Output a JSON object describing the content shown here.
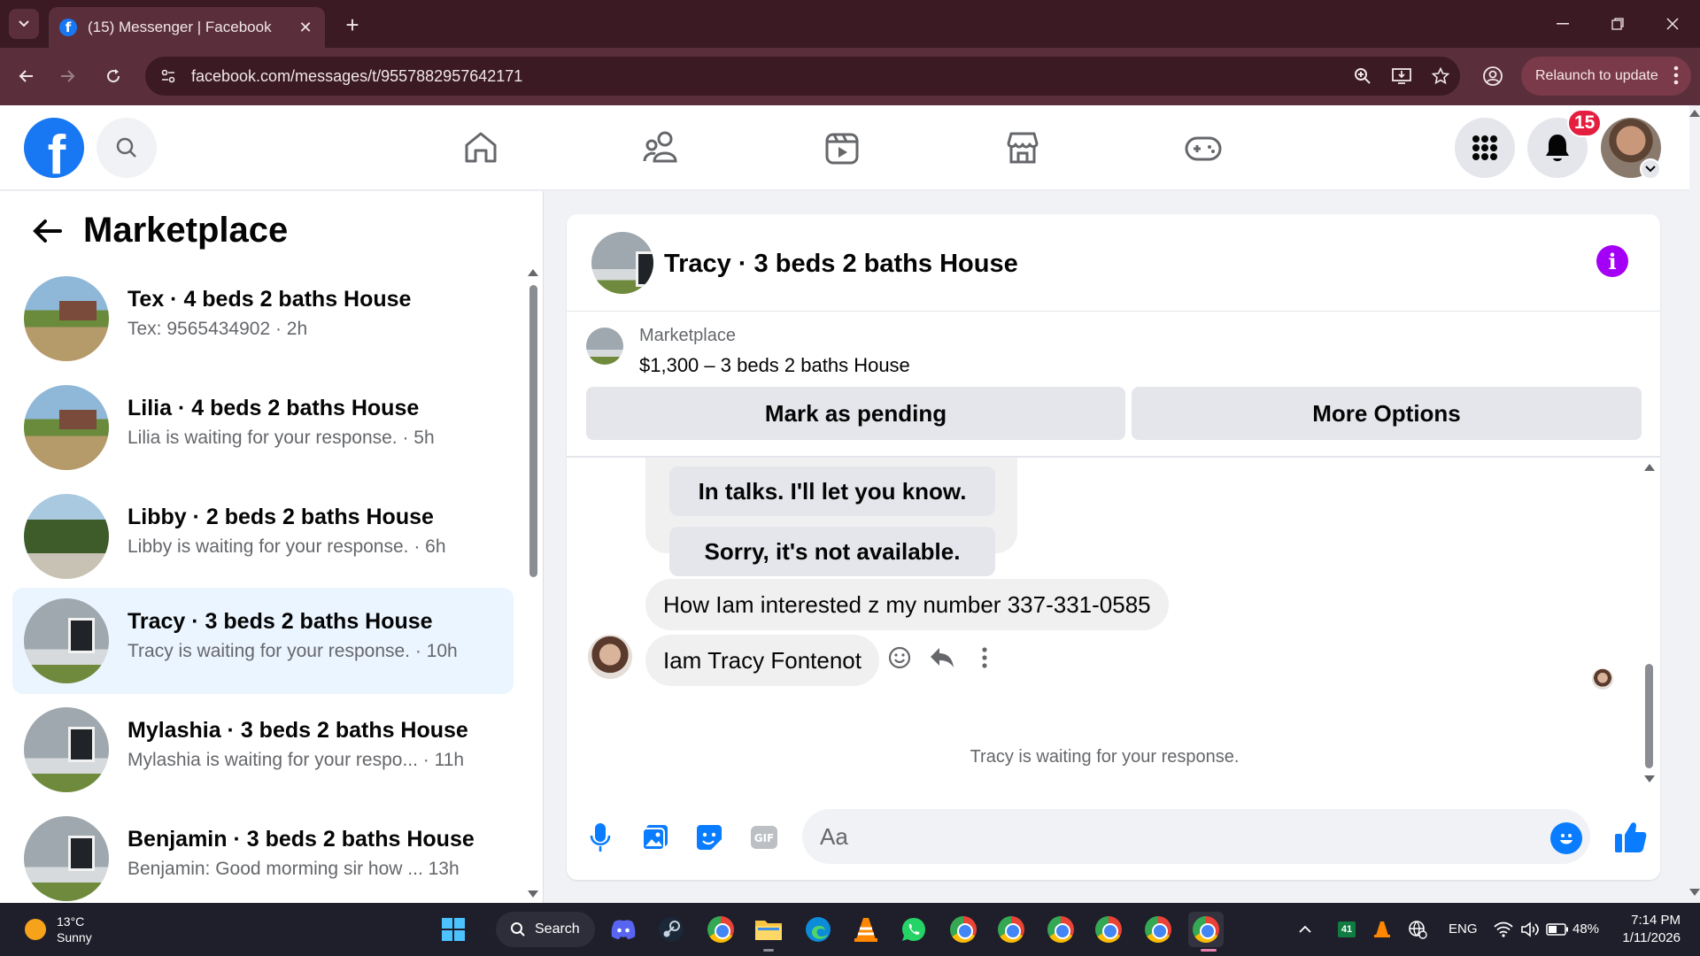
{
  "browser": {
    "tab_title": "(15) Messenger | Facebook",
    "url": "facebook.com/messages/t/9557882957642171",
    "relaunch_label": "Relaunch to update"
  },
  "fb_header": {
    "notification_count": "15",
    "nav_icons": [
      "home-icon",
      "friends-icon",
      "video-icon",
      "marketplace-icon",
      "gaming-icon"
    ]
  },
  "left_panel": {
    "title": "Marketplace",
    "conversations": [
      {
        "name": "Tex · 4 beds 2 baths House",
        "preview": "Tex: 9565434902 · 2h",
        "active": false
      },
      {
        "name": "Lilia · 4 beds 2 baths House",
        "preview": "Lilia is waiting for your response. · 5h",
        "active": false
      },
      {
        "name": "Libby · 2 beds 2 baths House",
        "preview": "Libby is waiting for your response. · 6h",
        "active": false
      },
      {
        "name": "Tracy · 3 beds 2 baths House",
        "preview": "Tracy is waiting for your response. · 10h",
        "active": true
      },
      {
        "name": "Mylashia · 3 beds 2 baths House",
        "preview": "Mylashia is waiting for your respo...  · 11h",
        "active": false
      },
      {
        "name": "Benjamin · 3 beds 2 baths House",
        "preview": "Benjamin: Good morming sir how ...  13h",
        "active": false
      }
    ]
  },
  "chat": {
    "title": "Tracy · 3 beds 2 baths House",
    "marketplace_label": "Marketplace",
    "listing": "$1,300 – 3 beds 2 baths House",
    "mark_pending_label": "Mark as pending",
    "more_options_label": "More Options",
    "quick_replies": [
      "In talks. I'll let you know.",
      "Sorry, it's not available."
    ],
    "messages": [
      {
        "text": "How Iam interested z my number 337-331-0585"
      },
      {
        "text": "Iam Tracy Fontenot"
      }
    ],
    "waiting_text": "Tracy is waiting for your response.",
    "composer_placeholder": "Aa"
  },
  "taskbar": {
    "temperature": "13°C",
    "weather": "Sunny",
    "search_label": "Search",
    "tray_badge": "41",
    "language": "ENG",
    "battery": "48%",
    "time": "7:14 PM",
    "date": "1/11/2026"
  },
  "colors": {
    "browser_frame": "#3b1a24",
    "browser_toolbar": "#5a2f3b",
    "fb_blue": "#1877f2",
    "messenger_blue": "#0a7cff",
    "info_purple": "#a400f5",
    "badge_red": "#e41e3f",
    "active_row": "#ebf5ff"
  }
}
